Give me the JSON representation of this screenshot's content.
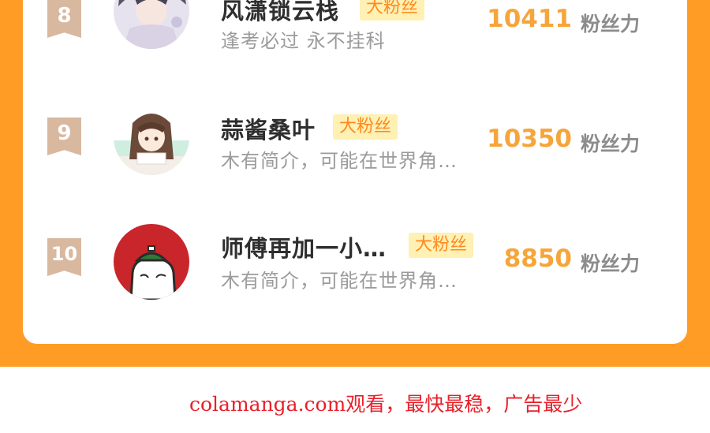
{
  "ranking": [
    {
      "rank": "8",
      "name": "风潇锁云栈",
      "badge": "大粉丝",
      "bio": "逢考必过 永不挂科",
      "score": "10411",
      "unit": "粉丝力",
      "avatar_icon": "anime-boy-avatar"
    },
    {
      "rank": "9",
      "name": "蒜酱桑叶",
      "badge": "大粉丝",
      "bio": "木有简介，可能在世界角…",
      "score": "10350",
      "unit": "粉丝力",
      "avatar_icon": "anime-girl-avatar"
    },
    {
      "rank": "10",
      "name": "师傅再加一小…",
      "badge": "大粉丝",
      "bio": "木有简介，可能在世界角…",
      "score": "8850",
      "unit": "粉丝力",
      "avatar_icon": "red-cartoon-avatar"
    }
  ],
  "footer_text": "colamanga.com观看，最快最稳，广告最少",
  "colors": {
    "accent_orange": "#ff9c25",
    "score": "#f6a53a",
    "badge_bg": "#fff0b3",
    "rank_flag": "#d9b8a0",
    "footer_red": "#e8202a"
  }
}
